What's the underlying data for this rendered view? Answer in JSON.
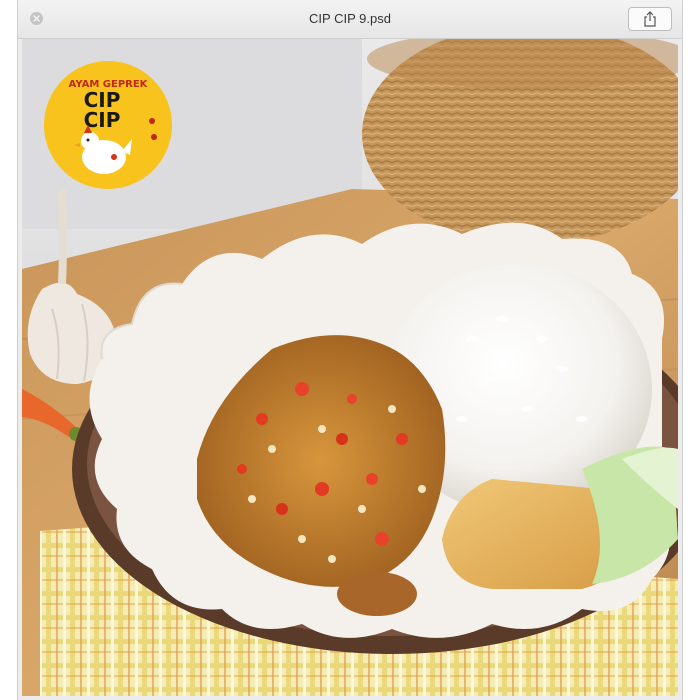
{
  "window": {
    "title": "CIP CIP 9.psd",
    "close_icon": "close-icon",
    "share_icon": "share-icon"
  },
  "logo": {
    "line1": "AYAM GEPREK",
    "line2": "CIP",
    "line3": "CIP",
    "badge_color": "#f7c31c",
    "mascot_icon": "chicken-mascot-icon"
  },
  "photo": {
    "subject": "ayam geprek plate with rice, tofu and cucumber"
  }
}
